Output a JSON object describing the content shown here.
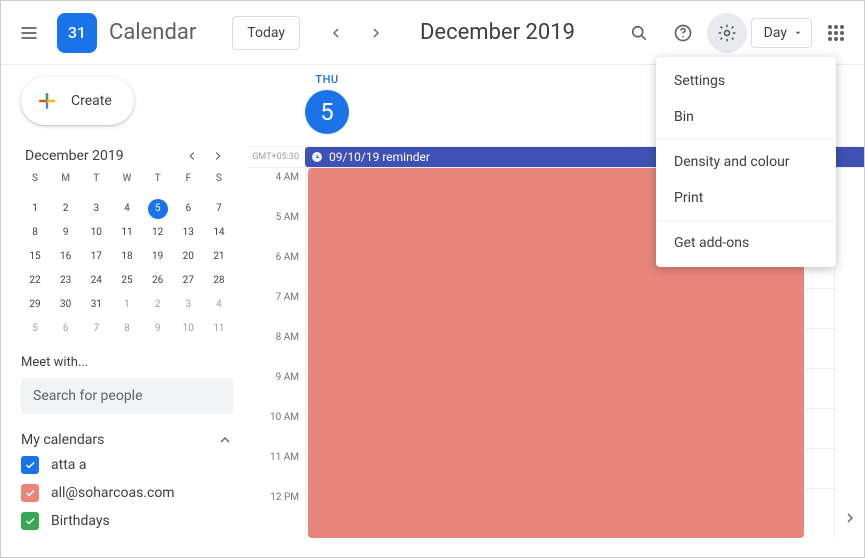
{
  "header": {
    "logo_day": "31",
    "app_title": "Calendar",
    "today_label": "Today",
    "date_range": "December 2019",
    "view_label": "Day"
  },
  "settings_menu": {
    "items": [
      "Settings",
      "Bin",
      "Density and colour",
      "Print",
      "Get add-ons"
    ]
  },
  "sidebar": {
    "create_label": "Create",
    "mini_month_label": "December 2019",
    "dow": [
      "S",
      "M",
      "T",
      "W",
      "T",
      "F",
      "S"
    ],
    "days": [
      {
        "n": "1"
      },
      {
        "n": "2"
      },
      {
        "n": "3"
      },
      {
        "n": "4"
      },
      {
        "n": "5",
        "today": true
      },
      {
        "n": "6"
      },
      {
        "n": "7"
      },
      {
        "n": "8"
      },
      {
        "n": "9"
      },
      {
        "n": "10"
      },
      {
        "n": "11"
      },
      {
        "n": "12"
      },
      {
        "n": "13"
      },
      {
        "n": "14"
      },
      {
        "n": "15"
      },
      {
        "n": "16"
      },
      {
        "n": "17"
      },
      {
        "n": "18"
      },
      {
        "n": "19"
      },
      {
        "n": "20"
      },
      {
        "n": "21"
      },
      {
        "n": "22"
      },
      {
        "n": "23"
      },
      {
        "n": "24"
      },
      {
        "n": "25"
      },
      {
        "n": "26"
      },
      {
        "n": "27"
      },
      {
        "n": "28"
      },
      {
        "n": "29"
      },
      {
        "n": "30"
      },
      {
        "n": "31"
      },
      {
        "n": "1",
        "other": true
      },
      {
        "n": "2",
        "other": true
      },
      {
        "n": "3",
        "other": true
      },
      {
        "n": "4",
        "other": true
      },
      {
        "n": "5",
        "other": true
      },
      {
        "n": "6",
        "other": true
      },
      {
        "n": "7",
        "other": true
      },
      {
        "n": "8",
        "other": true
      },
      {
        "n": "9",
        "other": true
      },
      {
        "n": "10",
        "other": true
      },
      {
        "n": "11",
        "other": true
      }
    ],
    "meet_with_label": "Meet with...",
    "search_people_placeholder": "Search for people",
    "my_calendars_label": "My calendars",
    "calendars": [
      {
        "label": "atta a",
        "color": "#1a73e8"
      },
      {
        "label": "all@soharcoas.com",
        "color": "#e8867c"
      },
      {
        "label": "Birthdays",
        "color": "#34a853"
      }
    ]
  },
  "day_view": {
    "dow_label": "THU",
    "day_num": "5",
    "timezone": "GMT+05:30",
    "allday_event": "09/10/19 reminder",
    "hours": [
      "4 AM",
      "5 AM",
      "6 AM",
      "7 AM",
      "8 AM",
      "9 AM",
      "10 AM",
      "11 AM",
      "12 PM"
    ]
  }
}
